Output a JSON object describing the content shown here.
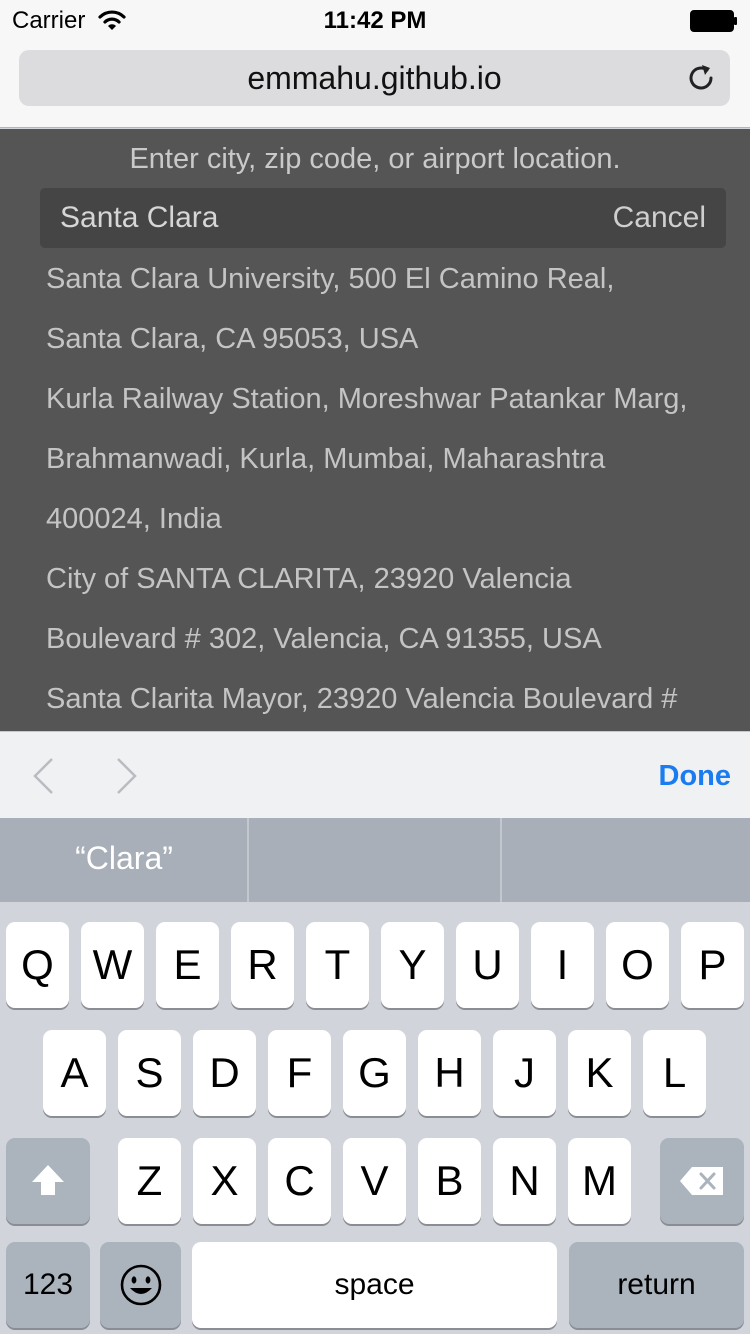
{
  "status_bar": {
    "carrier": "Carrier",
    "time": "11:42 PM"
  },
  "browser": {
    "url": "emmahu.github.io"
  },
  "page": {
    "hint": "Enter city, zip code, or airport location.",
    "search_value": "Santa Clara",
    "cancel_label": "Cancel",
    "result_lines": [
      "Santa Clara University, 500 El Camino Real,",
      "Santa Clara, CA 95053, USA",
      "Kurla Railway Station, Moreshwar Patankar Marg,",
      "Brahmanwadi, Kurla, Mumbai, Maharashtra",
      "400024, India",
      "City of SANTA CLARITA, 23920 Valencia",
      "Boulevard # 302, Valencia, CA 91355, USA",
      "Santa Clarita Mayor, 23920 Valencia Boulevard #"
    ]
  },
  "accessory": {
    "done_label": "Done"
  },
  "predictive": [
    "“Clara”",
    "",
    ""
  ],
  "keyboard": {
    "row1": [
      "Q",
      "W",
      "E",
      "R",
      "T",
      "Y",
      "U",
      "I",
      "O",
      "P"
    ],
    "row2": [
      "A",
      "S",
      "D",
      "F",
      "G",
      "H",
      "J",
      "K",
      "L"
    ],
    "row3": [
      "Z",
      "X",
      "C",
      "V",
      "B",
      "N",
      "M"
    ],
    "numbers_label": "123",
    "space_label": "space",
    "return_label": "return"
  },
  "colors": {
    "accent": "#1a7cf0",
    "page_bg": "#555555",
    "keyboard_bg": "#d1d5db"
  },
  "icons": [
    "wifi-icon",
    "battery-icon",
    "reload-icon",
    "chevron-left-icon",
    "chevron-right-icon",
    "shift-icon",
    "delete-icon",
    "emoji-icon"
  ]
}
